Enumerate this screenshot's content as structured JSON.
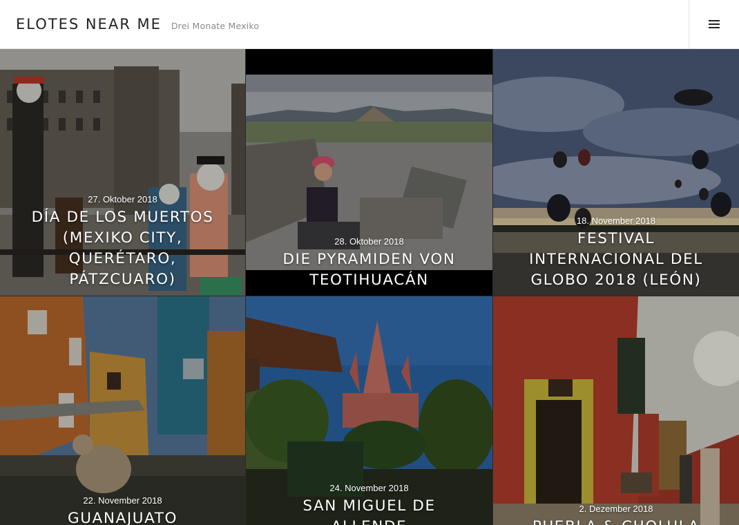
{
  "header": {
    "site_title": "ELOTES NEAR ME",
    "site_description": "Drei Monate Mexiko",
    "menu_icon": "hamburger-menu-icon"
  },
  "posts": [
    {
      "date": "27. Oktober 2018",
      "title": "DÍA DE LOS MUERTOS (MEXIKO CITY, QUERÉTARO, PÁTZCUARO)"
    },
    {
      "date": "28. Oktober 2018",
      "title": "DIE PYRAMIDEN VON TEOTIHUACÁN"
    },
    {
      "date": "18. November 2018",
      "title": "FESTIVAL INTERNACIONAL DEL GLOBO 2018 (LEÓN)"
    },
    {
      "date": "22. November 2018",
      "title": "GUANAJUATO"
    },
    {
      "date": "24. November 2018",
      "title": "SAN MIGUEL DE ALLENDE"
    },
    {
      "date": "2. Dezember 2018",
      "title": "PUEBLA & CHOLULA"
    }
  ]
}
